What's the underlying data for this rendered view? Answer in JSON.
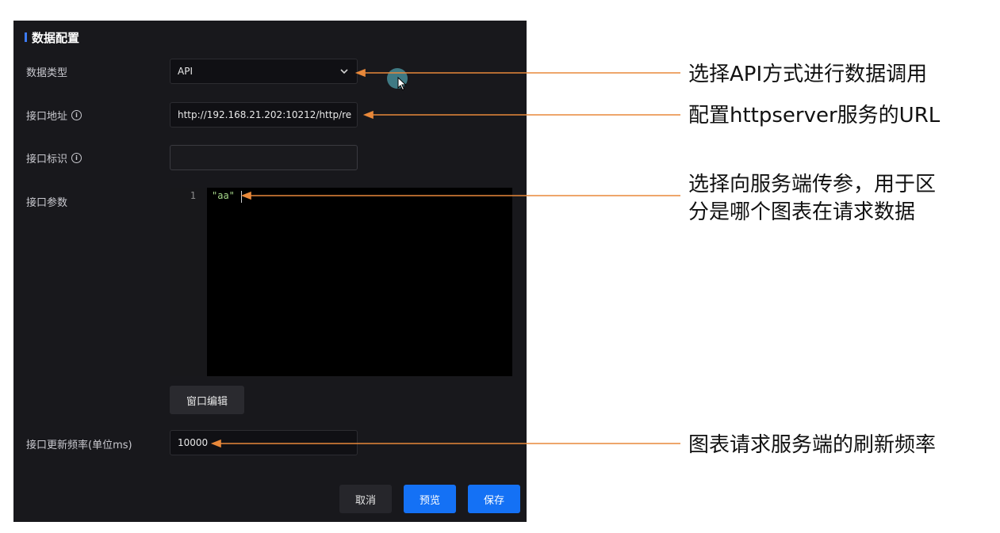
{
  "form": {
    "section_title": "数据配置",
    "data_type": {
      "label": "数据类型",
      "value": "API"
    },
    "api_url": {
      "label": "接口地址",
      "value": "http://192.168.21.202:10212/http/re"
    },
    "api_id": {
      "label": "接口标识",
      "value": ""
    },
    "api_params": {
      "label": "接口参数",
      "line_number": "1",
      "code": "\"aa\""
    },
    "window_edit_button": "窗口编辑",
    "refresh": {
      "label": "接口更新频率(单位ms)",
      "value": "10000"
    },
    "buttons": {
      "cancel": "取消",
      "preview": "预览",
      "save": "保存"
    },
    "info_icon_glyph": "i"
  },
  "annotations": [
    {
      "text": "选择API方式进行数据调用"
    },
    {
      "text": "配置httpserver服务的URL"
    },
    {
      "line1": "选择向服务端传参，用于区",
      "line2": "分是哪个图表在请求数据"
    },
    {
      "text": "图表请求服务端的刷新频率"
    }
  ],
  "colors": {
    "panel_bg": "#18181c",
    "accent_blue": "#1471f5",
    "annotation_arrow": "#e8883a"
  },
  "icons": {
    "select_arrow": "chevron-down-icon",
    "info": "info-circle-icon",
    "cursor": "mouse-pointer-icon"
  }
}
